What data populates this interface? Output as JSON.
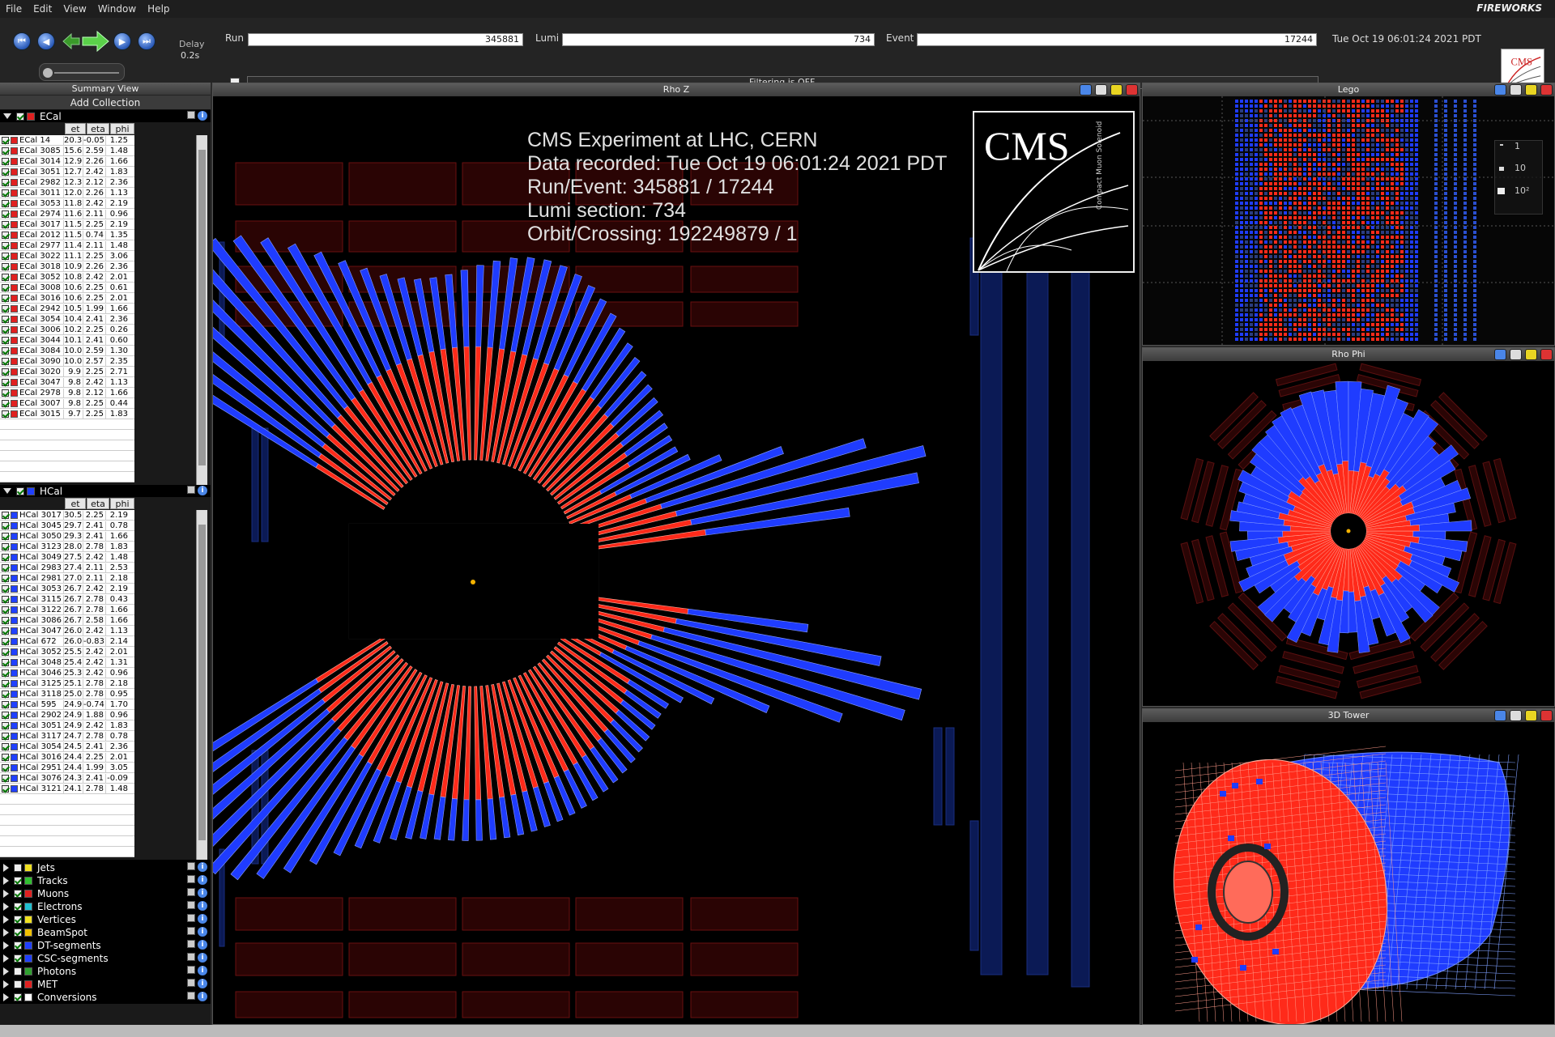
{
  "menu": [
    "File",
    "Edit",
    "View",
    "Window",
    "Help"
  ],
  "brand": "FIREWORKS",
  "toolbar": {
    "delay_label": "Delay",
    "delay_value": "0.2s",
    "run_label": "Run",
    "run_value": "345881",
    "lumi_label": "Lumi",
    "lumi_value": "734",
    "event_label": "Event",
    "event_value": "17244",
    "datetime": "Tue Oct 19 06:01:24 2021 PDT",
    "filter_status": "Filtering is OFF."
  },
  "summary": {
    "title": "Summary View",
    "add_collection": "Add Collection",
    "columns": [
      "et",
      "eta",
      "phi"
    ],
    "ecal": {
      "name": "ECal",
      "color": "#e02020",
      "rows": [
        [
          "ECal 14",
          "20.3",
          "-0.05",
          "1.25"
        ],
        [
          "ECal 3085",
          "15.6",
          "2.59",
          "1.48"
        ],
        [
          "ECal 3014",
          "12.9",
          "2.26",
          "1.66"
        ],
        [
          "ECal 3051",
          "12.7",
          "2.42",
          "1.83"
        ],
        [
          "ECal 2982",
          "12.3",
          "2.12",
          "2.36"
        ],
        [
          "ECal 3011",
          "12.0",
          "2.26",
          "1.13"
        ],
        [
          "ECal 3053",
          "11.8",
          "2.42",
          "2.19"
        ],
        [
          "ECal 2974",
          "11.6",
          "2.11",
          "0.96"
        ],
        [
          "ECal 3017",
          "11.5",
          "2.25",
          "2.19"
        ],
        [
          "ECal 2012",
          "11.5",
          "0.74",
          "1.35"
        ],
        [
          "ECal 2977",
          "11.4",
          "2.11",
          "1.48"
        ],
        [
          "ECal 3022",
          "11.1",
          "2.25",
          "3.06"
        ],
        [
          "ECal 3018",
          "10.9",
          "2.26",
          "2.36"
        ],
        [
          "ECal 3052",
          "10.8",
          "2.42",
          "2.01"
        ],
        [
          "ECal 3008",
          "10.6",
          "2.25",
          "0.61"
        ],
        [
          "ECal 3016",
          "10.6",
          "2.25",
          "2.01"
        ],
        [
          "ECal 2942",
          "10.5",
          "1.99",
          "1.66"
        ],
        [
          "ECal 3054",
          "10.4",
          "2.41",
          "2.36"
        ],
        [
          "ECal 3006",
          "10.2",
          "2.25",
          "0.26"
        ],
        [
          "ECal 3044",
          "10.1",
          "2.41",
          "0.60"
        ],
        [
          "ECal 3084",
          "10.0",
          "2.59",
          "1.30"
        ],
        [
          "ECal 3090",
          "10.0",
          "2.57",
          "2.35"
        ],
        [
          "ECal 3020",
          "9.9",
          "2.25",
          "2.71"
        ],
        [
          "ECal 3047",
          "9.8",
          "2.42",
          "1.13"
        ],
        [
          "ECal 2978",
          "9.8",
          "2.12",
          "1.66"
        ],
        [
          "ECal 3007",
          "9.8",
          "2.25",
          "0.44"
        ],
        [
          "ECal 3015",
          "9.7",
          "2.25",
          "1.83"
        ]
      ]
    },
    "hcal": {
      "name": "HCal",
      "color": "#2040ff",
      "rows": [
        [
          "HCal 3017",
          "30.5",
          "2.25",
          "2.19"
        ],
        [
          "HCal 3045",
          "29.7",
          "2.41",
          "0.78"
        ],
        [
          "HCal 3050",
          "29.3",
          "2.41",
          "1.66"
        ],
        [
          "HCal 3123",
          "28.0",
          "2.78",
          "1.83"
        ],
        [
          "HCal 3049",
          "27.5",
          "2.42",
          "1.48"
        ],
        [
          "HCal 2983",
          "27.4",
          "2.11",
          "2.53"
        ],
        [
          "HCal 2981",
          "27.0",
          "2.11",
          "2.18"
        ],
        [
          "HCal 3053",
          "26.7",
          "2.42",
          "2.19"
        ],
        [
          "HCal 3115",
          "26.7",
          "2.78",
          "0.43"
        ],
        [
          "HCal 3122",
          "26.7",
          "2.78",
          "1.66"
        ],
        [
          "HCal 3086",
          "26.7",
          "2.58",
          "1.66"
        ],
        [
          "HCal 3047",
          "26.0",
          "2.42",
          "1.13"
        ],
        [
          "HCal 672",
          "26.0",
          "-0.83",
          "2.14"
        ],
        [
          "HCal 3052",
          "25.5",
          "2.42",
          "2.01"
        ],
        [
          "HCal 3048",
          "25.4",
          "2.42",
          "1.31"
        ],
        [
          "HCal 3046",
          "25.3",
          "2.42",
          "0.96"
        ],
        [
          "HCal 3125",
          "25.1",
          "2.78",
          "2.18"
        ],
        [
          "HCal 3118",
          "25.0",
          "2.78",
          "0.95"
        ],
        [
          "HCal 595",
          "24.9",
          "-0.74",
          "1.70"
        ],
        [
          "HCal 2902",
          "24.9",
          "1.88",
          "0.96"
        ],
        [
          "HCal 3051",
          "24.9",
          "2.42",
          "1.83"
        ],
        [
          "HCal 3117",
          "24.7",
          "2.78",
          "0.78"
        ],
        [
          "HCal 3054",
          "24.5",
          "2.41",
          "2.36"
        ],
        [
          "HCal 3016",
          "24.4",
          "2.25",
          "2.01"
        ],
        [
          "HCal 2951",
          "24.4",
          "1.99",
          "3.05"
        ],
        [
          "HCal 3076",
          "24.3",
          "2.41",
          "-0.09"
        ],
        [
          "HCal 3121",
          "24.1",
          "2.78",
          "1.48"
        ]
      ]
    },
    "collections": [
      {
        "name": "Jets",
        "checked": false,
        "color": "#f0e020"
      },
      {
        "name": "Tracks",
        "checked": true,
        "color": "#30c030"
      },
      {
        "name": "Muons",
        "checked": true,
        "color": "#e02020"
      },
      {
        "name": "Electrons",
        "checked": true,
        "color": "#20c0d0"
      },
      {
        "name": "Vertices",
        "checked": true,
        "color": "#f0e020"
      },
      {
        "name": "BeamSpot",
        "checked": true,
        "color": "#f0c000"
      },
      {
        "name": "DT-segments",
        "checked": true,
        "color": "#2040ff"
      },
      {
        "name": "CSC-segments",
        "checked": true,
        "color": "#2040ff"
      },
      {
        "name": "Photons",
        "checked": false,
        "color": "#30a030"
      },
      {
        "name": "MET",
        "checked": false,
        "color": "#e02020"
      },
      {
        "name": "Conversions",
        "checked": true,
        "color": "#ffffff"
      }
    ]
  },
  "views": {
    "rhoz": {
      "title": "Rho Z"
    },
    "lego": {
      "title": "Lego",
      "legend": [
        "1",
        "10",
        "10²"
      ]
    },
    "rhophi": {
      "title": "Rho Phi"
    },
    "tower": {
      "title": "3D Tower"
    }
  },
  "overlay": {
    "line1": "CMS Experiment at LHC, CERN",
    "line2": "Data recorded: Tue Oct 19 06:01:24 2021 PDT",
    "line3": "Run/Event: 345881 / 17244",
    "line4": "Lumi section: 734",
    "line5": "Orbit/Crossing: 192249879 / 1",
    "logo_text": "CMS",
    "logo_sub": "Compact Muon Solenoid"
  },
  "colors": {
    "ecal": "#ff2a1a",
    "hcal": "#1f3cff",
    "muon": "#3a0808",
    "background": "#000000"
  }
}
